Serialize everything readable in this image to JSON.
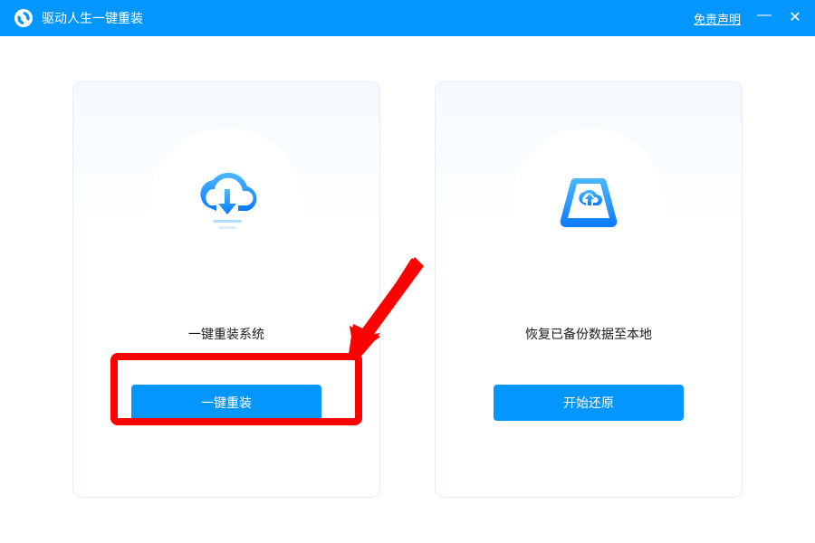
{
  "titlebar": {
    "app_title": "驱动人生一键重装",
    "disclaimer": "免责声明"
  },
  "cards": {
    "reinstall": {
      "title": "一键重装系统",
      "button_label": "一键重装",
      "icon": "cloud-download-icon"
    },
    "restore": {
      "title": "恢复已备份数据至本地",
      "button_label": "开始还原",
      "icon": "drive-upload-icon"
    }
  },
  "colors": {
    "primary": "#0396ff",
    "highlight": "#ff0000"
  }
}
